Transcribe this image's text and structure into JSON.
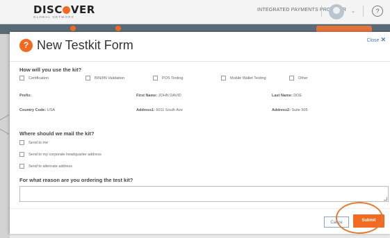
{
  "header": {
    "logo_text_a": "DISC",
    "logo_text_b": "VER",
    "logo_sub": "GLOBAL NETWORK",
    "provider": "INTEGRATED PAYMENTS PROVIDER",
    "help_glyph": "?",
    "dropdown_glyph": "⌄"
  },
  "modal": {
    "title_icon": "?",
    "title": "New Testkit Form",
    "close_label": "Close",
    "close_glyph": "✕",
    "use_section": {
      "heading": "How will you use the kit?",
      "options": [
        "Certification",
        "BIN/IIN Validation",
        "POS Testing",
        "Mobile Wallet Testing",
        "Other"
      ]
    },
    "fields": {
      "prefix_label": "Prefix:",
      "prefix_value": "",
      "first_name_label": "First Name:",
      "first_name_value": "JOHN DAVID",
      "last_name_label": "Last Name:",
      "last_name_value": "DOE",
      "country_label": "Country Code:",
      "country_value": "USA",
      "address1_label": "Address1:",
      "address1_value": "6011 South Ave",
      "address2_label": "Address2:",
      "address2_value": "Suite 505"
    },
    "mail_section": {
      "heading": "Where should we mail the kit?",
      "options": [
        "Send to me",
        "Send to my corporate headquarter address",
        "Send to alternate address"
      ]
    },
    "reason_section": {
      "heading": "For what reason are you ordering the test kit?",
      "value": ""
    },
    "buttons": {
      "cancel": "Cance",
      "submit": "Submit"
    }
  },
  "colors": {
    "accent": "#f26a21",
    "link": "#4a78b0",
    "nav": "#5a6b78"
  }
}
